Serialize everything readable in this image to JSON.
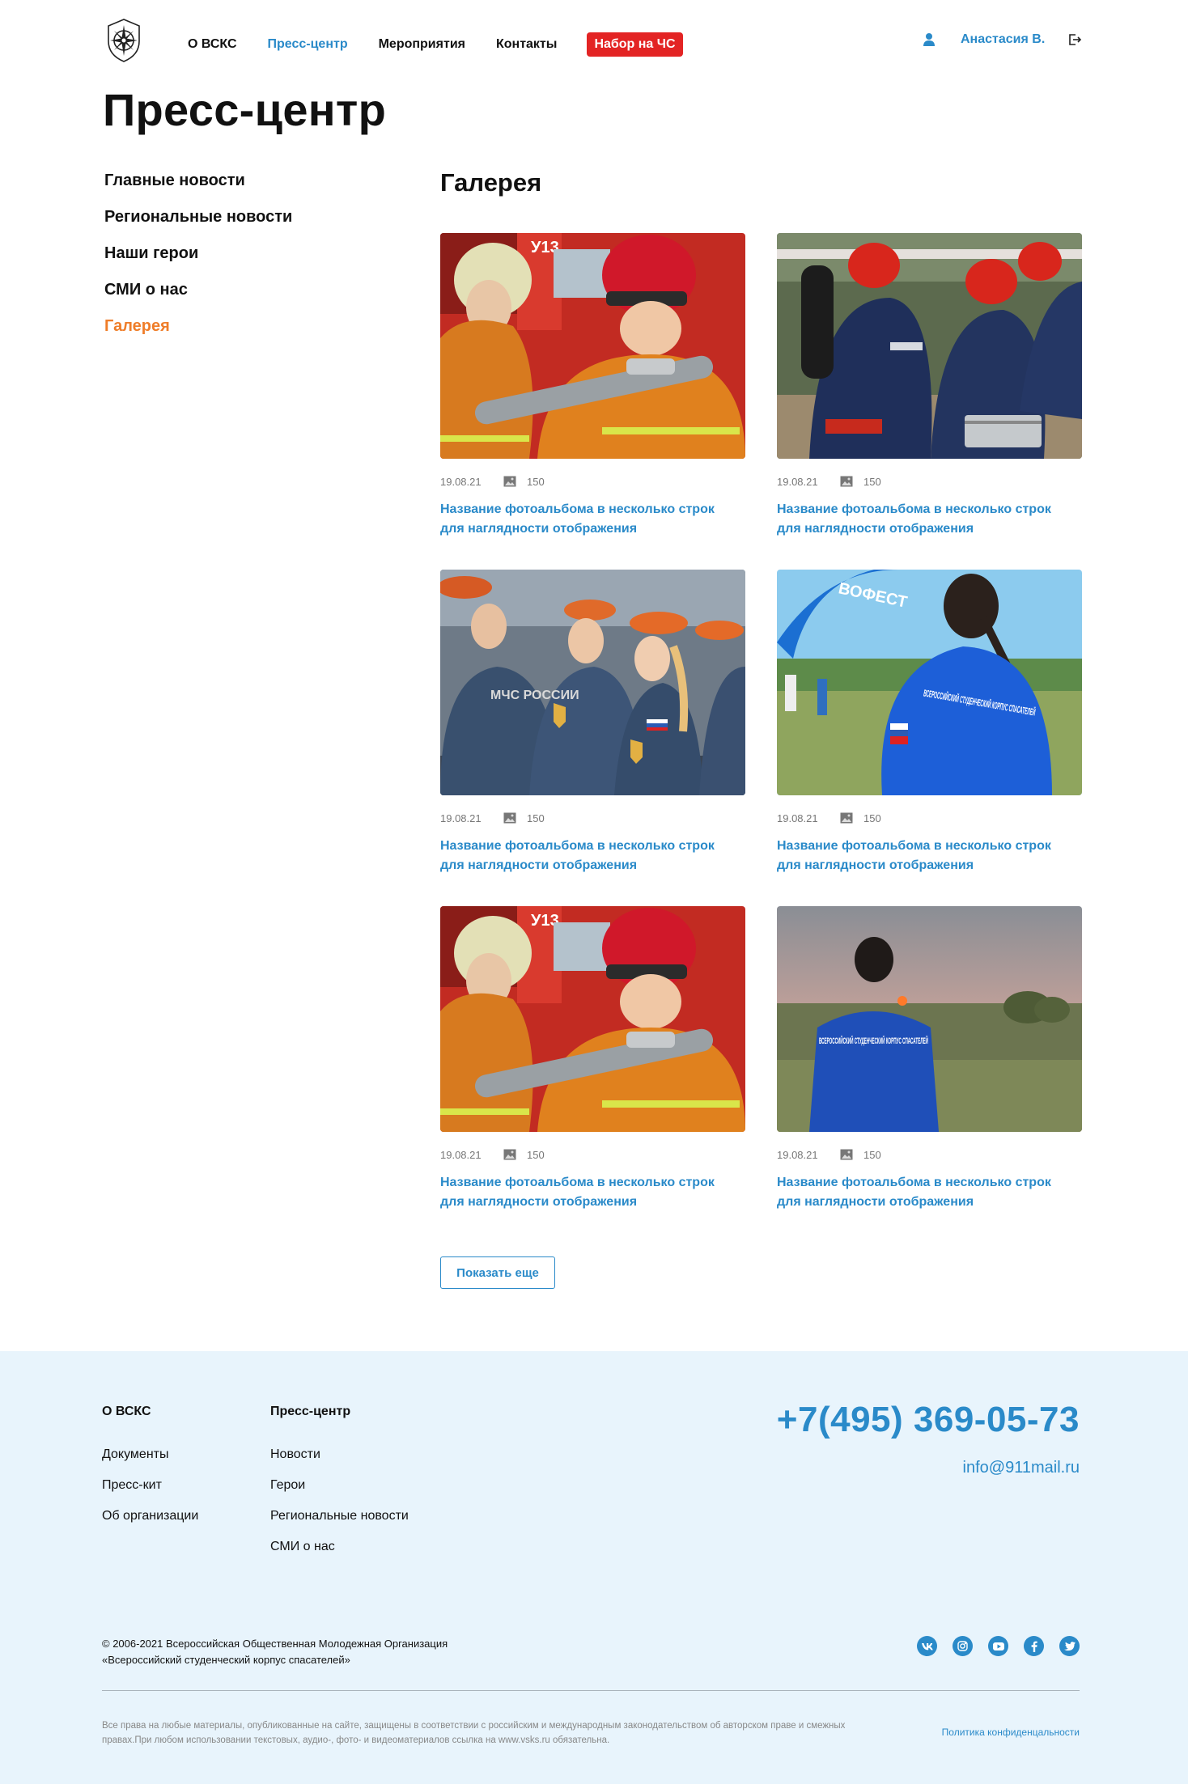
{
  "header": {
    "nav": [
      "О ВСКС",
      "Пресс-центр",
      "Мероприятия",
      "Контакты"
    ],
    "cta": "Набор на ЧС",
    "user_name": "Анастасия В."
  },
  "page_title": "Пресс-центр",
  "sidebar": {
    "items": [
      {
        "label": "Главные новости",
        "active": false
      },
      {
        "label": "Региональные новости",
        "active": false
      },
      {
        "label": "Наши герои",
        "active": false
      },
      {
        "label": "СМИ о нас",
        "active": false
      },
      {
        "label": "Галерея",
        "active": true
      }
    ]
  },
  "gallery": {
    "title": "Галерея",
    "cards": [
      {
        "date": "19.08.21",
        "count": "150",
        "title": "Название фотоальбома в несколько строк для наглядности отображения",
        "scene": "firefighters-hose"
      },
      {
        "date": "19.08.21",
        "count": "150",
        "title": "Название фотоальбома в несколько строк для наглядности отображения",
        "scene": "rescuers-kneeling"
      },
      {
        "date": "19.08.21",
        "count": "150",
        "title": "Название фотоальбома в несколько строк для наглядности отображения",
        "scene": "cadets-berets"
      },
      {
        "date": "19.08.21",
        "count": "150",
        "title": "Название фотоальбома в несколько строк для наглядности отображения",
        "scene": "girl-blue-shirt"
      },
      {
        "date": "19.08.21",
        "count": "150",
        "title": "Название фотоальбома в несколько строк для наглядности отображения",
        "scene": "firefighters-hose"
      },
      {
        "date": "19.08.21",
        "count": "150",
        "title": "Название фотоальбома в несколько строк для наглядности отображения",
        "scene": "sunset-field"
      }
    ],
    "photo_text": {
      "mchs_patch": "МЧС РОССИИ",
      "shirt_back": "ВСЕРОССИЙСКИЙ СТУДЕНЧЕСКИЙ КОРПУС СПАСАТЕЛЕЙ",
      "arch_banner": "ВОФЕСТ",
      "truck_sign": "У13"
    },
    "more_button": "Показать еще"
  },
  "footer": {
    "col1": {
      "title": "О ВСКС",
      "links": [
        "Документы",
        "Пресс-кит",
        "Об организации"
      ]
    },
    "col2": {
      "title": "Пресс-центр",
      "links": [
        "Новости",
        "Герои",
        "Региональные новости",
        "СМИ о нас"
      ]
    },
    "phone": "+7(495) 369-05-73",
    "email": "info@911mail.ru",
    "copyright_line1": "© 2006-2021 Всероссийская Общественная Молодежная Организация",
    "copyright_line2": "«Всероссийский студенческий корпус спасателей»",
    "socials": [
      "vk-icon",
      "instagram-icon",
      "youtube-icon",
      "facebook-icon",
      "twitter-icon"
    ],
    "rights": "Все права на любые материалы, опубликованные на сайте, защищены в соответствии с российским и международным законодательством об авторском праве и смежных правах.При любом использовании текстовых, аудио-, фото- и видеоматериалов ссылка на www.vsks.ru обязательна.",
    "privacy": "Политика конфиденцальности"
  },
  "colors": {
    "accent": "#2a8ac9",
    "active_side": "#ef7d29",
    "cta": "#e32424",
    "footer_bg": "#e8f4fc"
  }
}
